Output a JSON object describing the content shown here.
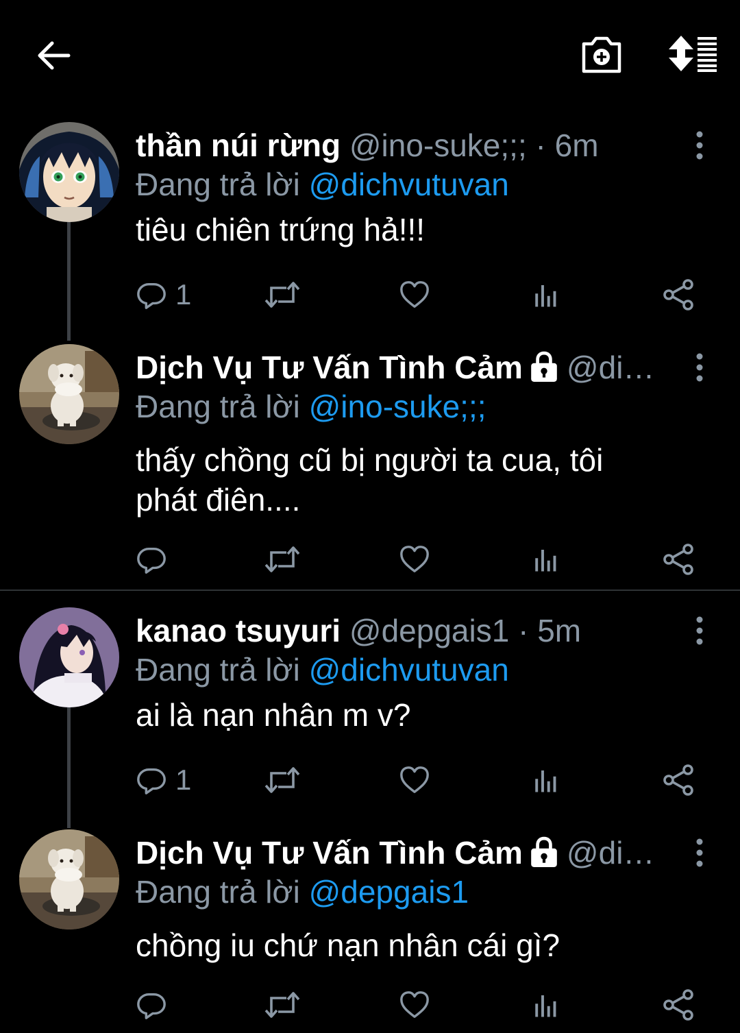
{
  "topbar": {
    "back_icon": "arrow-left-icon",
    "camera_icon": "camera-plus-icon",
    "sort_icon": "sort-icon"
  },
  "colors": {
    "background": "#000000",
    "text": "#ffffff",
    "muted": "#8b98a5",
    "link": "#1d9bf0",
    "thread_line": "#3d4146"
  },
  "tweets": [
    {
      "name": "thần núi rừng",
      "handle": "@ino-suke;;;",
      "separator": "·",
      "time": "6m",
      "reply_prefix": "Đang trả lời",
      "reply_to": "@dichvutuvan",
      "text_lines": [
        "tiêu chiên trứng hả!!!"
      ],
      "reply_count": "1",
      "protected": false
    },
    {
      "name": "Dịch Vụ Tư Vấn Tình Cảm",
      "handle": "@di…",
      "separator": "",
      "time": "",
      "reply_prefix": "Đang trả lời",
      "reply_to": "@ino-suke;;;",
      "text_lines": [
        "thấy chồng cũ bị người ta cua, tôi",
        "phát điên...."
      ],
      "reply_count": "",
      "protected": true
    },
    {
      "name": "kanao tsuyuri",
      "handle": "@depgais1",
      "separator": "·",
      "time": "5m",
      "reply_prefix": "Đang trả lời",
      "reply_to": "@dichvutuvan",
      "text_lines": [
        "ai là nạn nhân m v?"
      ],
      "reply_count": "1",
      "protected": false
    },
    {
      "name": "Dịch Vụ Tư Vấn Tình Cảm",
      "handle": "@di…",
      "separator": "",
      "time": "",
      "reply_prefix": "Đang trả lời",
      "reply_to": "@depgais1",
      "text_lines": [
        "chồng iu chứ nạn nhân cái gì?"
      ],
      "reply_count": "",
      "protected": true
    }
  ]
}
